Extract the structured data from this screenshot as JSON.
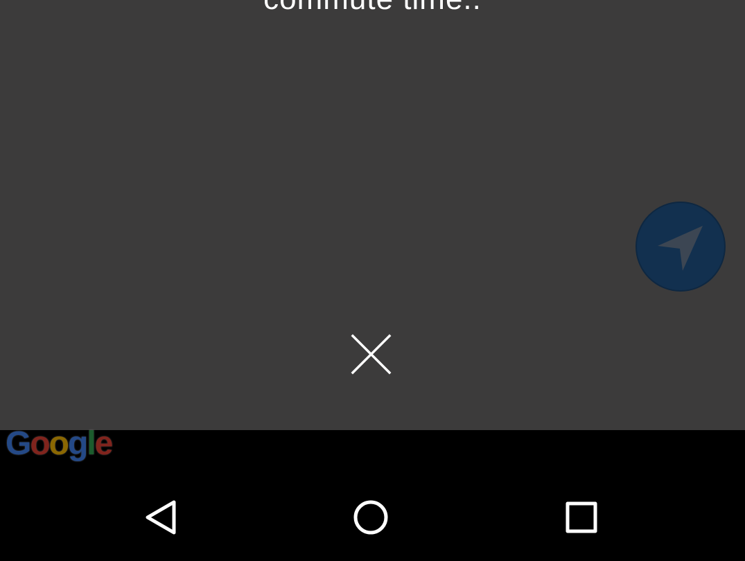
{
  "overlay": {
    "header_text": "commute time..",
    "close_icon": "close-icon",
    "navigate_icon": "navigation-arrow-icon"
  },
  "map": {
    "logo_letters": [
      "G",
      "o",
      "o",
      "g",
      "l",
      "e"
    ],
    "logo_colors": [
      "#4285F4",
      "#EA4335",
      "#FBBC05",
      "#4285F4",
      "#34A853",
      "#EA4335"
    ]
  },
  "system_nav": {
    "back_icon": "back-triangle-icon",
    "home_icon": "home-circle-icon",
    "recents_icon": "recents-square-icon"
  },
  "colors": {
    "overlay_bg": "#3c3b3b",
    "fab_bg": "#12304f",
    "nav_bg": "#000000"
  }
}
